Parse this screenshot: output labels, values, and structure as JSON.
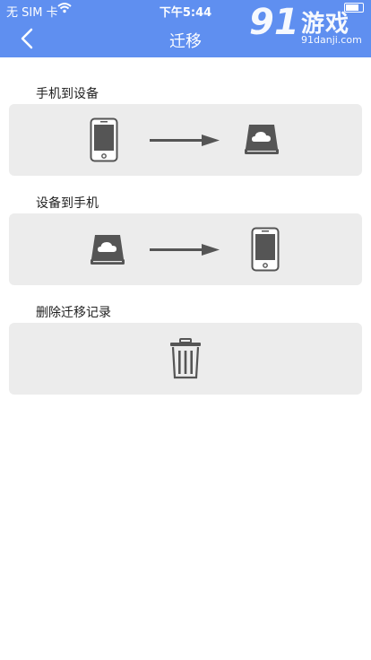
{
  "status": {
    "carrier": "无 SIM 卡",
    "time": "下午5:44"
  },
  "header": {
    "title": "迁移"
  },
  "brand": {
    "logo_num": "91",
    "logo_cn": "游戏",
    "logo_url": "91danji.com"
  },
  "sections": [
    {
      "label": "手机到设备"
    },
    {
      "label": "设备到手机"
    },
    {
      "label": "删除迁移记录"
    }
  ],
  "icons": {
    "back": "chevron-left-icon",
    "phone": "phone-icon",
    "device": "cloud-drive-icon",
    "arrow": "arrow-right-icon",
    "trash": "trash-icon"
  },
  "colors": {
    "accent": "#5f8ff0",
    "card": "#ececec",
    "icon": "#555555"
  }
}
